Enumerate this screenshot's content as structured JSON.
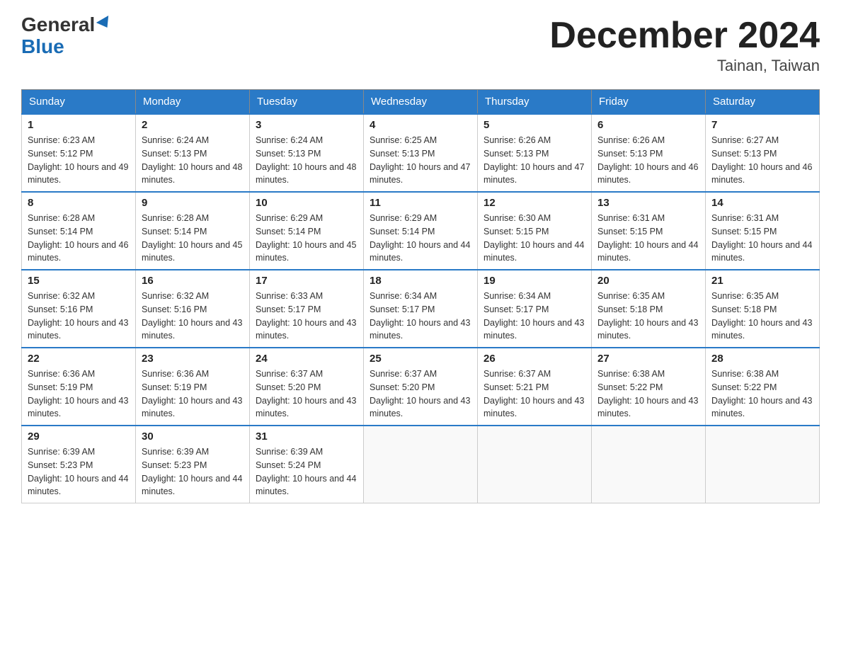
{
  "header": {
    "logo_general": "General",
    "logo_blue": "Blue",
    "month_title": "December 2024",
    "location": "Tainan, Taiwan"
  },
  "columns": [
    "Sunday",
    "Monday",
    "Tuesday",
    "Wednesday",
    "Thursday",
    "Friday",
    "Saturday"
  ],
  "weeks": [
    [
      {
        "day": "1",
        "sunrise": "6:23 AM",
        "sunset": "5:12 PM",
        "daylight": "10 hours and 49 minutes."
      },
      {
        "day": "2",
        "sunrise": "6:24 AM",
        "sunset": "5:13 PM",
        "daylight": "10 hours and 48 minutes."
      },
      {
        "day": "3",
        "sunrise": "6:24 AM",
        "sunset": "5:13 PM",
        "daylight": "10 hours and 48 minutes."
      },
      {
        "day": "4",
        "sunrise": "6:25 AM",
        "sunset": "5:13 PM",
        "daylight": "10 hours and 47 minutes."
      },
      {
        "day": "5",
        "sunrise": "6:26 AM",
        "sunset": "5:13 PM",
        "daylight": "10 hours and 47 minutes."
      },
      {
        "day": "6",
        "sunrise": "6:26 AM",
        "sunset": "5:13 PM",
        "daylight": "10 hours and 46 minutes."
      },
      {
        "day": "7",
        "sunrise": "6:27 AM",
        "sunset": "5:13 PM",
        "daylight": "10 hours and 46 minutes."
      }
    ],
    [
      {
        "day": "8",
        "sunrise": "6:28 AM",
        "sunset": "5:14 PM",
        "daylight": "10 hours and 46 minutes."
      },
      {
        "day": "9",
        "sunrise": "6:28 AM",
        "sunset": "5:14 PM",
        "daylight": "10 hours and 45 minutes."
      },
      {
        "day": "10",
        "sunrise": "6:29 AM",
        "sunset": "5:14 PM",
        "daylight": "10 hours and 45 minutes."
      },
      {
        "day": "11",
        "sunrise": "6:29 AM",
        "sunset": "5:14 PM",
        "daylight": "10 hours and 44 minutes."
      },
      {
        "day": "12",
        "sunrise": "6:30 AM",
        "sunset": "5:15 PM",
        "daylight": "10 hours and 44 minutes."
      },
      {
        "day": "13",
        "sunrise": "6:31 AM",
        "sunset": "5:15 PM",
        "daylight": "10 hours and 44 minutes."
      },
      {
        "day": "14",
        "sunrise": "6:31 AM",
        "sunset": "5:15 PM",
        "daylight": "10 hours and 44 minutes."
      }
    ],
    [
      {
        "day": "15",
        "sunrise": "6:32 AM",
        "sunset": "5:16 PM",
        "daylight": "10 hours and 43 minutes."
      },
      {
        "day": "16",
        "sunrise": "6:32 AM",
        "sunset": "5:16 PM",
        "daylight": "10 hours and 43 minutes."
      },
      {
        "day": "17",
        "sunrise": "6:33 AM",
        "sunset": "5:17 PM",
        "daylight": "10 hours and 43 minutes."
      },
      {
        "day": "18",
        "sunrise": "6:34 AM",
        "sunset": "5:17 PM",
        "daylight": "10 hours and 43 minutes."
      },
      {
        "day": "19",
        "sunrise": "6:34 AM",
        "sunset": "5:17 PM",
        "daylight": "10 hours and 43 minutes."
      },
      {
        "day": "20",
        "sunrise": "6:35 AM",
        "sunset": "5:18 PM",
        "daylight": "10 hours and 43 minutes."
      },
      {
        "day": "21",
        "sunrise": "6:35 AM",
        "sunset": "5:18 PM",
        "daylight": "10 hours and 43 minutes."
      }
    ],
    [
      {
        "day": "22",
        "sunrise": "6:36 AM",
        "sunset": "5:19 PM",
        "daylight": "10 hours and 43 minutes."
      },
      {
        "day": "23",
        "sunrise": "6:36 AM",
        "sunset": "5:19 PM",
        "daylight": "10 hours and 43 minutes."
      },
      {
        "day": "24",
        "sunrise": "6:37 AM",
        "sunset": "5:20 PM",
        "daylight": "10 hours and 43 minutes."
      },
      {
        "day": "25",
        "sunrise": "6:37 AM",
        "sunset": "5:20 PM",
        "daylight": "10 hours and 43 minutes."
      },
      {
        "day": "26",
        "sunrise": "6:37 AM",
        "sunset": "5:21 PM",
        "daylight": "10 hours and 43 minutes."
      },
      {
        "day": "27",
        "sunrise": "6:38 AM",
        "sunset": "5:22 PM",
        "daylight": "10 hours and 43 minutes."
      },
      {
        "day": "28",
        "sunrise": "6:38 AM",
        "sunset": "5:22 PM",
        "daylight": "10 hours and 43 minutes."
      }
    ],
    [
      {
        "day": "29",
        "sunrise": "6:39 AM",
        "sunset": "5:23 PM",
        "daylight": "10 hours and 44 minutes."
      },
      {
        "day": "30",
        "sunrise": "6:39 AM",
        "sunset": "5:23 PM",
        "daylight": "10 hours and 44 minutes."
      },
      {
        "day": "31",
        "sunrise": "6:39 AM",
        "sunset": "5:24 PM",
        "daylight": "10 hours and 44 minutes."
      },
      null,
      null,
      null,
      null
    ]
  ]
}
